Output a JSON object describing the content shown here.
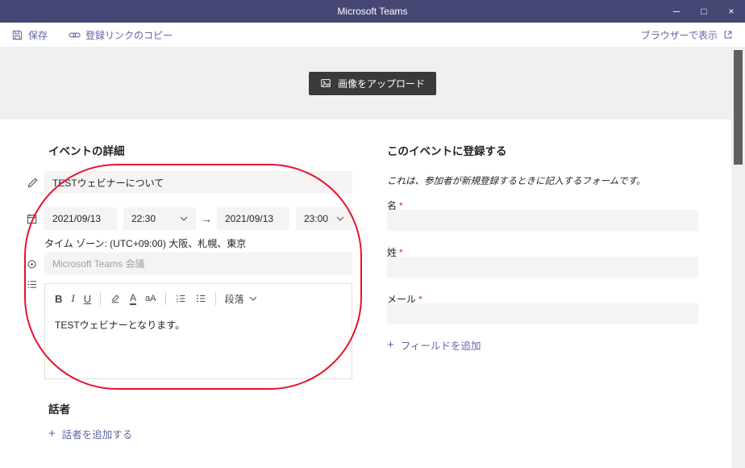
{
  "titlebar": {
    "title": "Microsoft Teams",
    "minimize_glyph": "─",
    "maximize_glyph": "□",
    "close_glyph": "×"
  },
  "toolbar": {
    "save_label": "保存",
    "copy_link_label": "登録リンクのコピー",
    "view_browser_label": "ブラウザーで表示"
  },
  "banner": {
    "upload_image_label": "画像をアップロード"
  },
  "event_details": {
    "heading": "イベントの詳細",
    "title_value": "TESTウェビナーについて",
    "start_date": "2021/09/13",
    "start_time": "22:30",
    "arrow_glyph": "→",
    "end_date": "2021/09/13",
    "end_time": "23:00",
    "timezone_label": "タイム ゾーン: (UTC+09:00) 大阪、札幌、東京",
    "location_placeholder": "Microsoft Teams 会議",
    "description_value": "TESTウェビナーとなります。",
    "editor": {
      "bold_label": "B",
      "italic_label": "I",
      "underline_label": "U",
      "font_color_label": "A",
      "font_size_label": "aA",
      "paragraph_label": "段落"
    }
  },
  "speakers": {
    "heading": "話者",
    "add_speaker_label": "話者を追加する"
  },
  "registration": {
    "heading": "このイベントに登録する",
    "description": "これは、参加者が新規登録するときに記入するフォームです。",
    "fields": [
      {
        "label": "名",
        "required_mark": "*"
      },
      {
        "label": "姓",
        "required_mark": "*"
      },
      {
        "label": "メール",
        "required_mark": "*"
      }
    ],
    "add_field_label": "フィールドを追加"
  },
  "icons": {
    "plus_glyph": "+"
  },
  "colors": {
    "titlebar_bg": "#464775",
    "accent": "#6264a7",
    "required": "#c4314b",
    "annotation_red": "#e8112d"
  }
}
